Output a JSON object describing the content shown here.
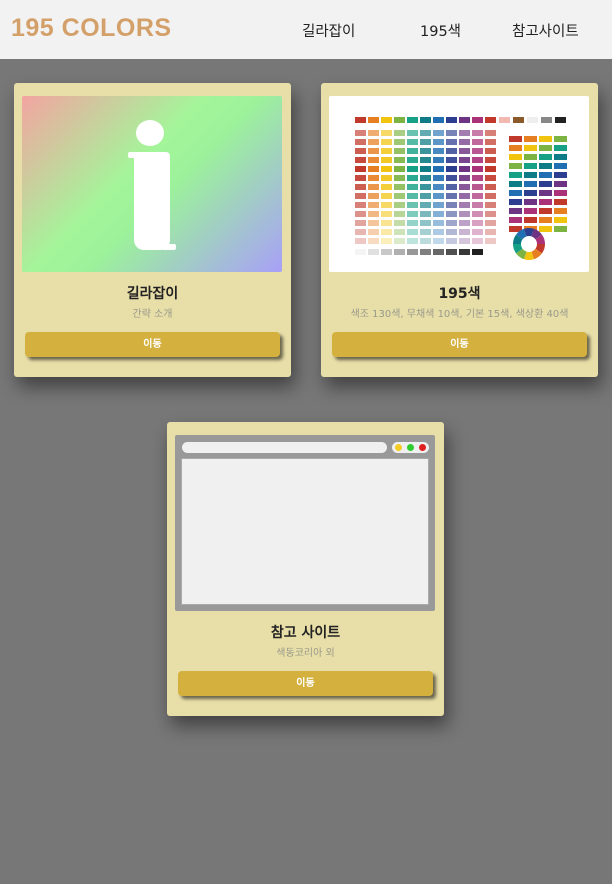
{
  "header": {
    "logo": "195 COLORS",
    "nav": [
      "길라잡이",
      "195색",
      "참고사이트"
    ]
  },
  "cards": [
    {
      "title": "길라잡이",
      "desc": "간략 소개",
      "button": "이동",
      "thumb": "info-icon"
    },
    {
      "title": "195색",
      "desc": "색조 130색, 무채색 10색, 기본 15색, 색상환 40색",
      "button": "이동",
      "thumb": "color-chart"
    },
    {
      "title": "참고 사이트",
      "desc": "색동코리아 외",
      "button": "이동",
      "thumb": "browser-window"
    }
  ]
}
